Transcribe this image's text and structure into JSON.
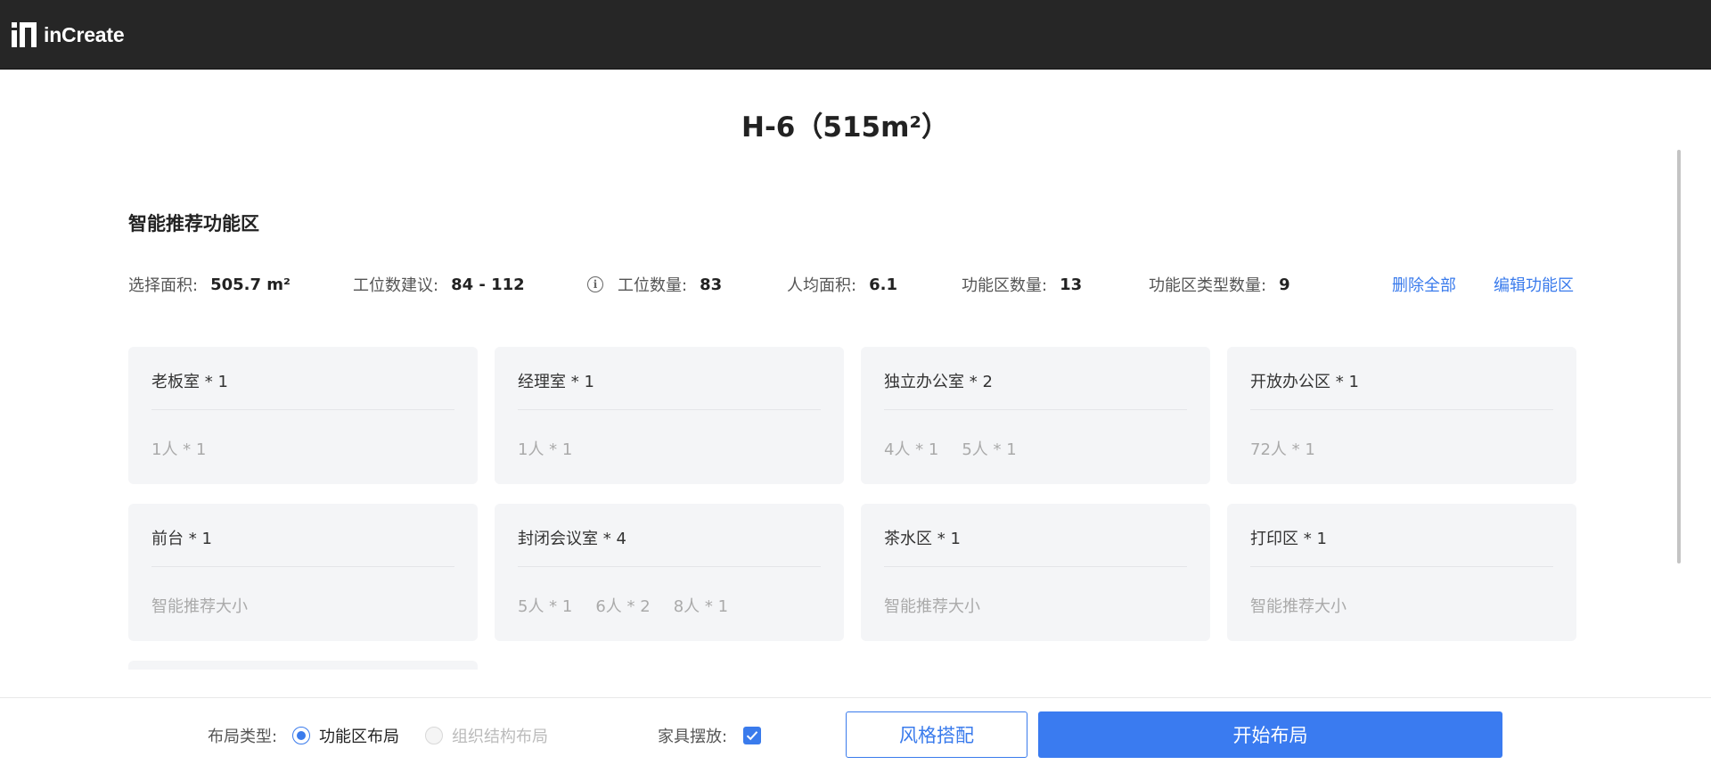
{
  "header": {
    "logo_text": "inCreate"
  },
  "page": {
    "title": "H-6（515m²）"
  },
  "section": {
    "title": "智能推荐功能区"
  },
  "stats": {
    "area_label": "选择面积:",
    "area_value": "505.7 m²",
    "workstation_suggest_label": "工位数建议:",
    "workstation_suggest_value": "84 - 112",
    "info_icon": "i",
    "workstation_count_label": "工位数量:",
    "workstation_count_value": "83",
    "per_capita_label": "人均面积:",
    "per_capita_value": "6.1",
    "zone_count_label": "功能区数量:",
    "zone_count_value": "13",
    "zone_type_count_label": "功能区类型数量:",
    "zone_type_count_value": "9"
  },
  "actions": {
    "delete_all": "删除全部",
    "edit_zones": "编辑功能区"
  },
  "cards": [
    {
      "name": "老板室 * 1",
      "details": [
        "1人 * 1"
      ]
    },
    {
      "name": "经理室 * 1",
      "details": [
        "1人 * 1"
      ]
    },
    {
      "name": "独立办公室 * 2",
      "details": [
        "4人 * 1",
        "5人 * 1"
      ]
    },
    {
      "name": "开放办公区 * 1",
      "details": [
        "72人 * 1"
      ]
    },
    {
      "name": "前台 * 1",
      "details": [
        "智能推荐大小"
      ]
    },
    {
      "name": "封闭会议室 * 4",
      "details": [
        "5人 * 1",
        "6人 * 2",
        "8人 * 1"
      ]
    },
    {
      "name": "茶水区 * 1",
      "details": [
        "智能推荐大小"
      ]
    },
    {
      "name": "打印区 * 1",
      "details": [
        "智能推荐大小"
      ]
    }
  ],
  "footer": {
    "layout_type_label": "布局类型:",
    "option_zone_layout": "功能区布局",
    "option_org_layout": "组织结构布局",
    "furniture_label": "家具摆放:",
    "style_button": "风格搭配",
    "start_button": "开始布局"
  },
  "colors": {
    "accent": "#3a7bec",
    "topbar": "#262626",
    "card_bg": "#f4f5f7"
  }
}
